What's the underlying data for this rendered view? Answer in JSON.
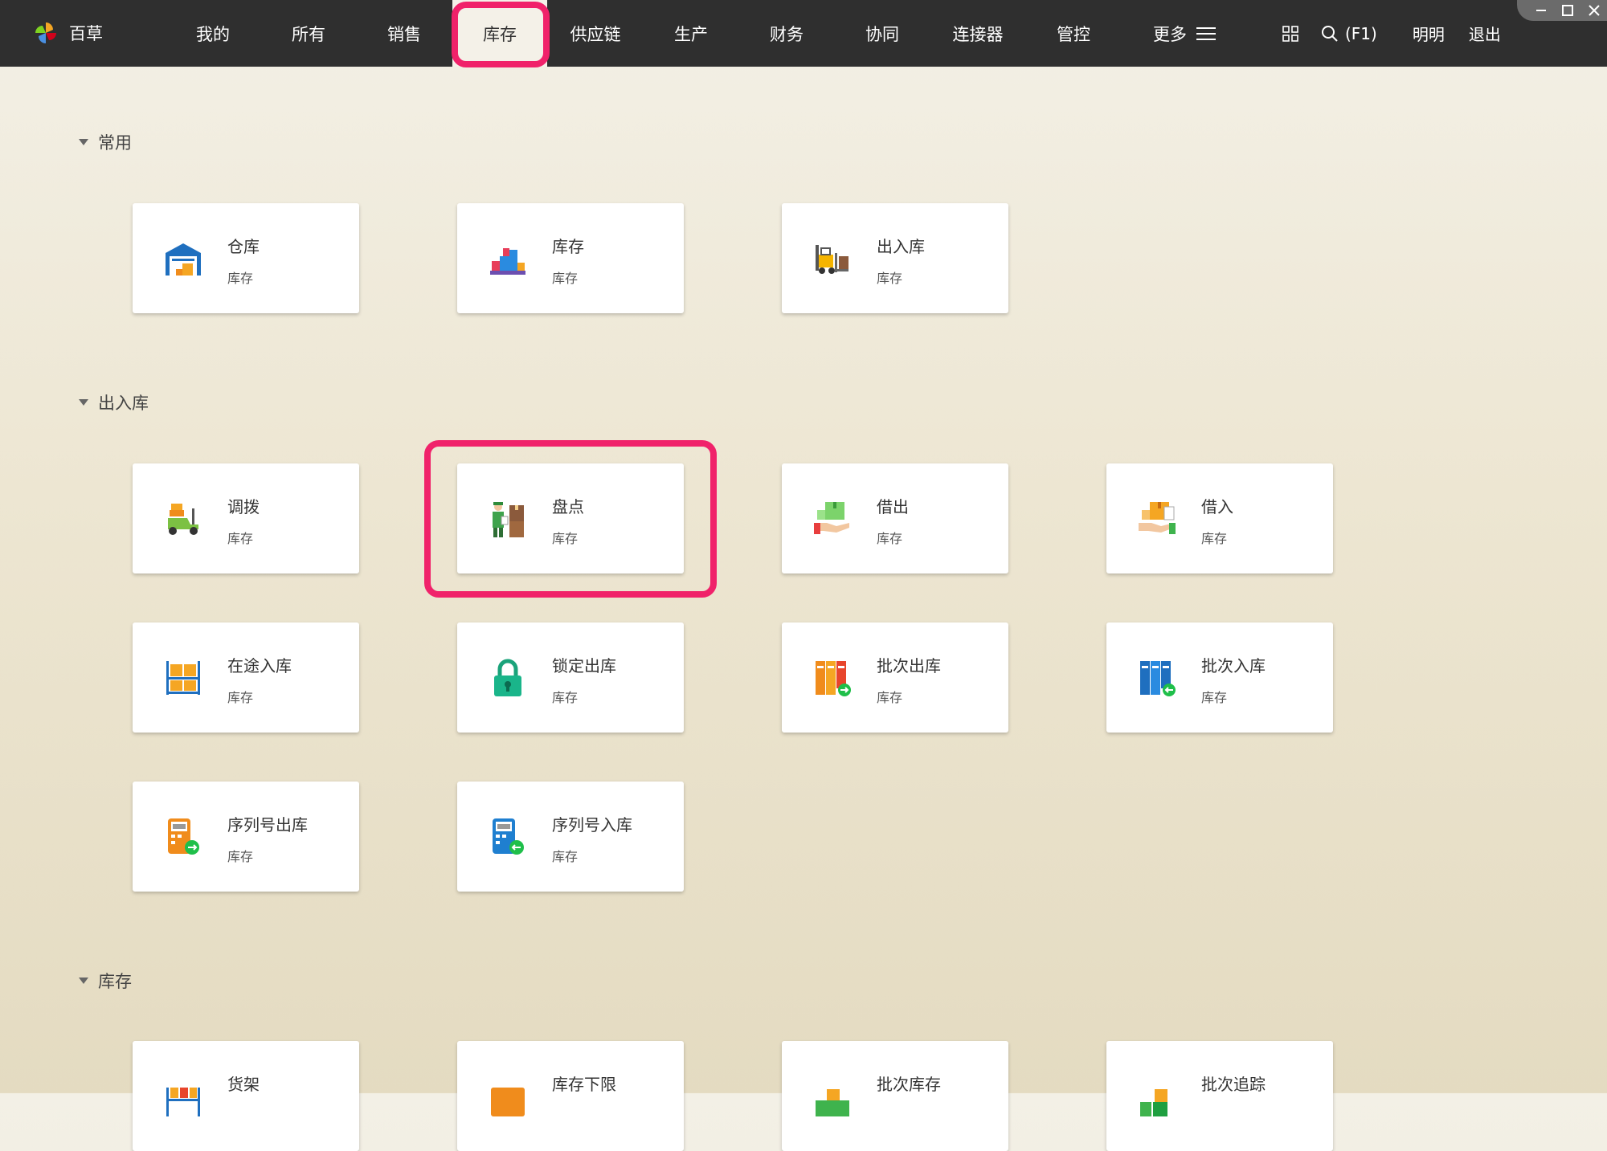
{
  "app": {
    "brand": "百草"
  },
  "nav": {
    "items": [
      "我的",
      "所有",
      "销售",
      "库存",
      "供应链",
      "生产",
      "财务",
      "协同",
      "连接器",
      "管控"
    ],
    "more": "更多",
    "search_shortcut": "(F1)",
    "user": "明明",
    "logout": "退出",
    "active": "库存"
  },
  "sections": {
    "common": {
      "title": "常用"
    },
    "inout": {
      "title": "出入库"
    },
    "stock": {
      "title": "库存"
    }
  },
  "cards": {
    "warehouse": {
      "title": "仓库",
      "sub": "库存"
    },
    "inventory": {
      "title": "库存",
      "sub": "库存"
    },
    "inout": {
      "title": "出入库",
      "sub": "库存"
    },
    "transfer": {
      "title": "调拨",
      "sub": "库存"
    },
    "stocktake": {
      "title": "盘点",
      "sub": "库存"
    },
    "lend": {
      "title": "借出",
      "sub": "库存"
    },
    "borrow": {
      "title": "借入",
      "sub": "库存"
    },
    "in_transit": {
      "title": "在途入库",
      "sub": "库存"
    },
    "lock_out": {
      "title": "锁定出库",
      "sub": "库存"
    },
    "batch_out": {
      "title": "批次出库",
      "sub": "库存"
    },
    "batch_in": {
      "title": "批次入库",
      "sub": "库存"
    },
    "serial_out": {
      "title": "序列号出库",
      "sub": "库存"
    },
    "serial_in": {
      "title": "序列号入库",
      "sub": "库存"
    },
    "shelf": {
      "title": "货架"
    },
    "stock_min": {
      "title": "库存下限"
    },
    "batch_stock": {
      "title": "批次库存"
    },
    "batch_trace": {
      "title": "批次追踪"
    }
  },
  "colors": {
    "topbar": "#2f2f2f",
    "highlight": "#f0226a",
    "active_tab_bg": "#f4f1e8"
  }
}
